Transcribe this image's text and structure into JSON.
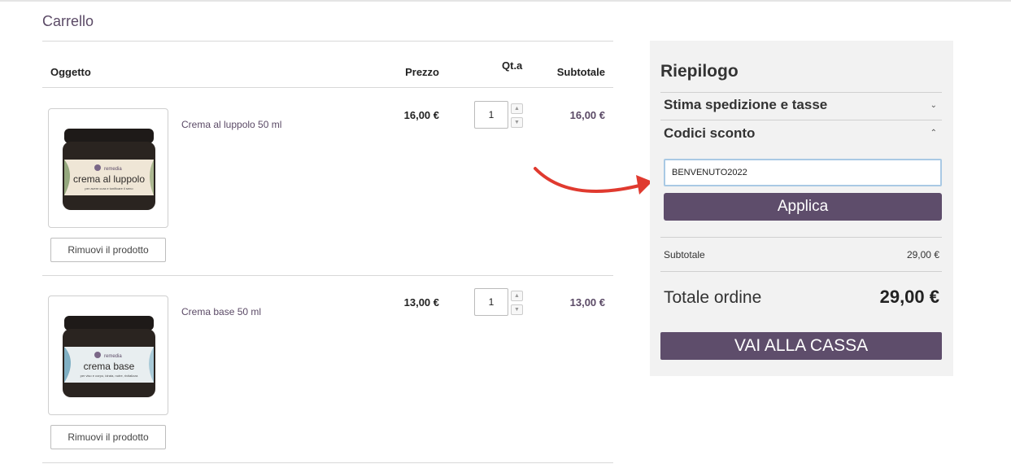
{
  "page": {
    "title": "Carrello"
  },
  "cart": {
    "headers": {
      "item": "Oggetto",
      "price": "Prezzo",
      "qty": "Qt.a",
      "subtotal": "Subtotale"
    },
    "items": [
      {
        "name": "Crema al luppolo 50 ml",
        "price": "16,00 €",
        "qty": "1",
        "subtotal": "16,00 €",
        "remove_label": "Rimuovi il prodotto",
        "brand": "remedia",
        "jar_label": "crema al luppolo",
        "jar_small": "per avere cura e tonificare il seno",
        "jar_color": "#efe6d6"
      },
      {
        "name": "Crema base 50 ml",
        "price": "13,00 €",
        "qty": "1",
        "subtotal": "13,00 €",
        "remove_label": "Rimuovi il prodotto",
        "brand": "remedia",
        "jar_label": "crema base",
        "jar_small": "per viso e corpo, idrata, nutre, rivitalizza",
        "jar_color": "#e8eef0"
      }
    ]
  },
  "summary": {
    "title": "Riepilogo",
    "shipping_label": "Stima spedizione e tasse",
    "discount_label": "Codici sconto",
    "discount_code": "BENVENUTO2022",
    "apply_label": "Applica",
    "subtotal_label": "Subtotale",
    "subtotal_value": "29,00 €",
    "total_label": "Totale ordine",
    "total_value": "29,00 €",
    "checkout_label": "VAI ALLA CASSA"
  },
  "colors": {
    "accent": "#5e4d6b",
    "annotation_arrow": "#e03a2f"
  }
}
